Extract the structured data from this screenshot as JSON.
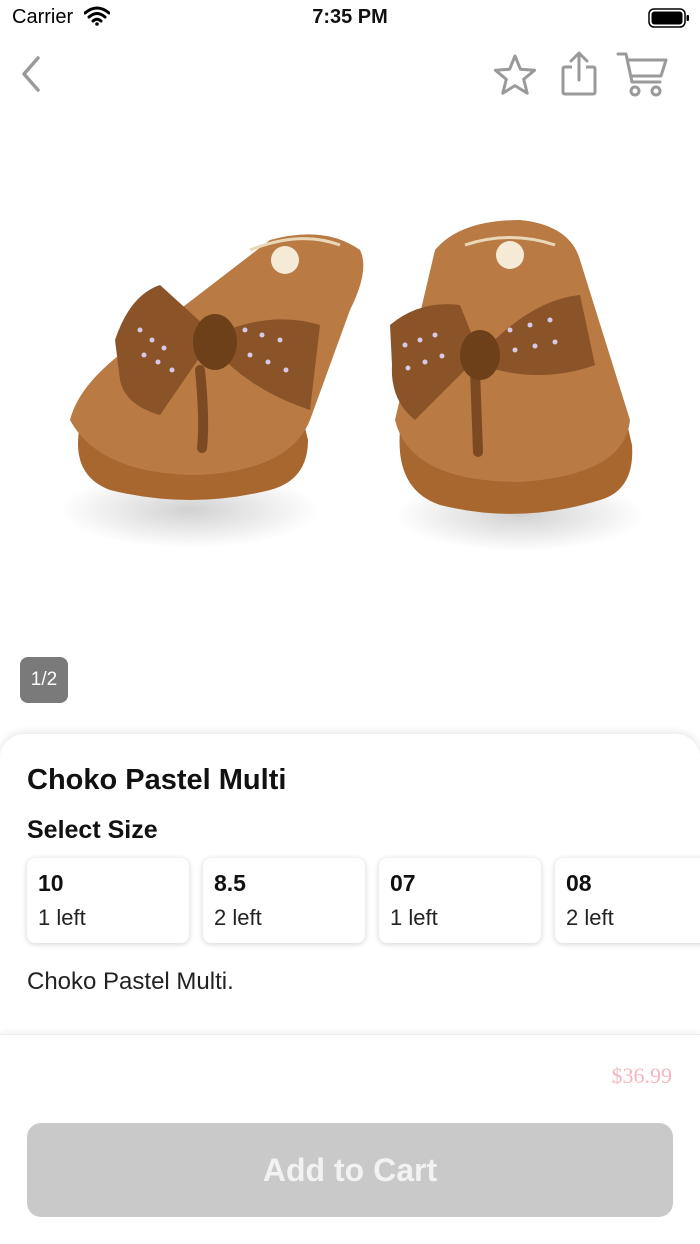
{
  "status_bar": {
    "carrier": "Carrier",
    "time": "7:35 PM",
    "icons": [
      "wifi-icon",
      "battery-icon"
    ]
  },
  "nav": {
    "icons": [
      "back-icon",
      "star-icon",
      "share-icon",
      "cart-icon"
    ]
  },
  "gallery": {
    "page_indicator": "1/2"
  },
  "product": {
    "title": "Choko Pastel Multi",
    "size_heading": "Select Size",
    "sizes": [
      {
        "size": "10",
        "stock": "1 left"
      },
      {
        "size": "8.5",
        "stock": "2 left"
      },
      {
        "size": "07",
        "stock": "1 left"
      },
      {
        "size": "08",
        "stock": "2 left"
      }
    ],
    "description": "Choko Pastel Multi."
  },
  "purchase": {
    "price": "$36.99",
    "add_to_cart_label": "Add to Cart"
  },
  "colors": {
    "price": "#f4b6bf",
    "button_bg": "#c9c9c9",
    "indicator_bg": "#7a7a7a",
    "sandal": "#b5763f"
  }
}
